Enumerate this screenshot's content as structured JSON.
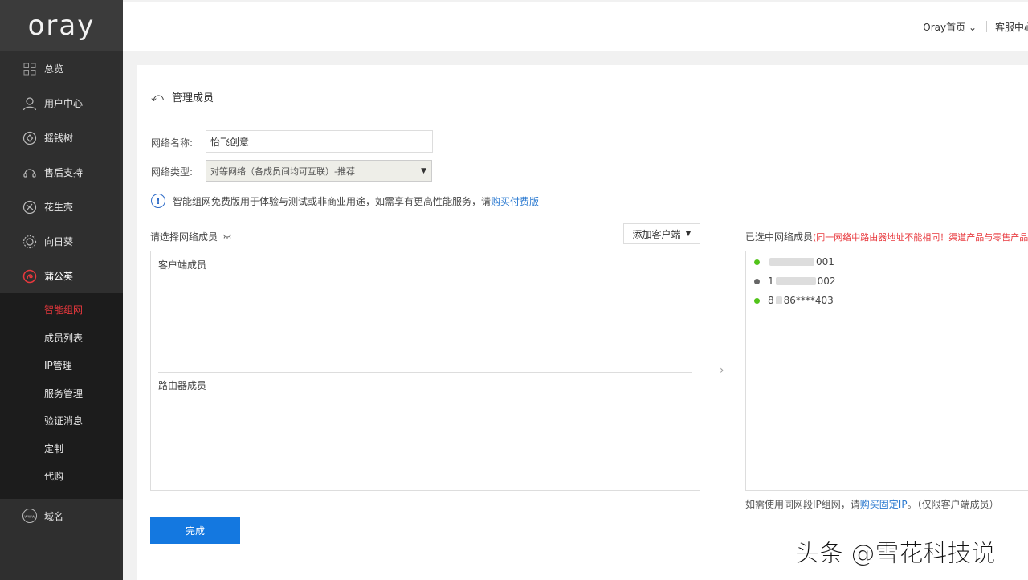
{
  "brand": {
    "logo_text": "oray"
  },
  "sidebar": {
    "items": [
      {
        "label": "总览",
        "icon": "grid-icon"
      },
      {
        "label": "用户中心",
        "icon": "user-icon"
      },
      {
        "label": "摇钱树",
        "icon": "money-tree-icon"
      },
      {
        "label": "售后支持",
        "icon": "headset-icon"
      },
      {
        "label": "花生壳",
        "icon": "peanut-shell-icon"
      },
      {
        "label": "向日葵",
        "icon": "sunflower-icon"
      },
      {
        "label": "蒲公英",
        "icon": "dandelion-icon"
      }
    ],
    "subitems": [
      {
        "label": "智能组网",
        "active": true
      },
      {
        "label": "成员列表"
      },
      {
        "label": "IP管理"
      },
      {
        "label": "服务管理"
      },
      {
        "label": "验证消息"
      },
      {
        "label": "定制"
      },
      {
        "label": "代购"
      }
    ],
    "bottom_item": {
      "label": "域名",
      "icon": "www-icon"
    }
  },
  "topbar": {
    "home_label": "Oray首页",
    "service_label": "客服中心"
  },
  "page": {
    "title": "管理成员"
  },
  "form": {
    "name_label": "网络名称:",
    "name_value": "怡飞创意",
    "type_label": "网络类型:",
    "type_value": "对等网络（各成员间均可互联）-推荐"
  },
  "notice": {
    "text": "智能组网免费版用于体验与测试或非商业用途，如需享有更高性能服务，请",
    "link": "购买付费版"
  },
  "left_panel": {
    "heading": "请选择网络成员",
    "add_button": "添加客户端",
    "client_section": "客户端成员",
    "router_section": "路由器成员"
  },
  "right_panel": {
    "heading": "已选中网络成员",
    "warning": "(同一网络中路由器地址不能相同！渠道产品与零售产品不",
    "members": [
      {
        "suffix": "001",
        "status_color": "#52c41a"
      },
      {
        "prefix": "1",
        "suffix": "002",
        "status_color": "#666666"
      },
      {
        "prefix": "8",
        "suffix": "86****403",
        "status_color": "#52c41a"
      }
    ]
  },
  "hint": {
    "before": "如需使用同网段IP组网，请",
    "link": "购买固定IP",
    "after": "。（仅限客户端成员）"
  },
  "actions": {
    "done_label": "完成"
  },
  "watermark": "头条 @雪花科技说",
  "colors": {
    "accent_red": "#e8383d",
    "primary_blue": "#1478e0",
    "link_blue": "#2a79d0"
  }
}
